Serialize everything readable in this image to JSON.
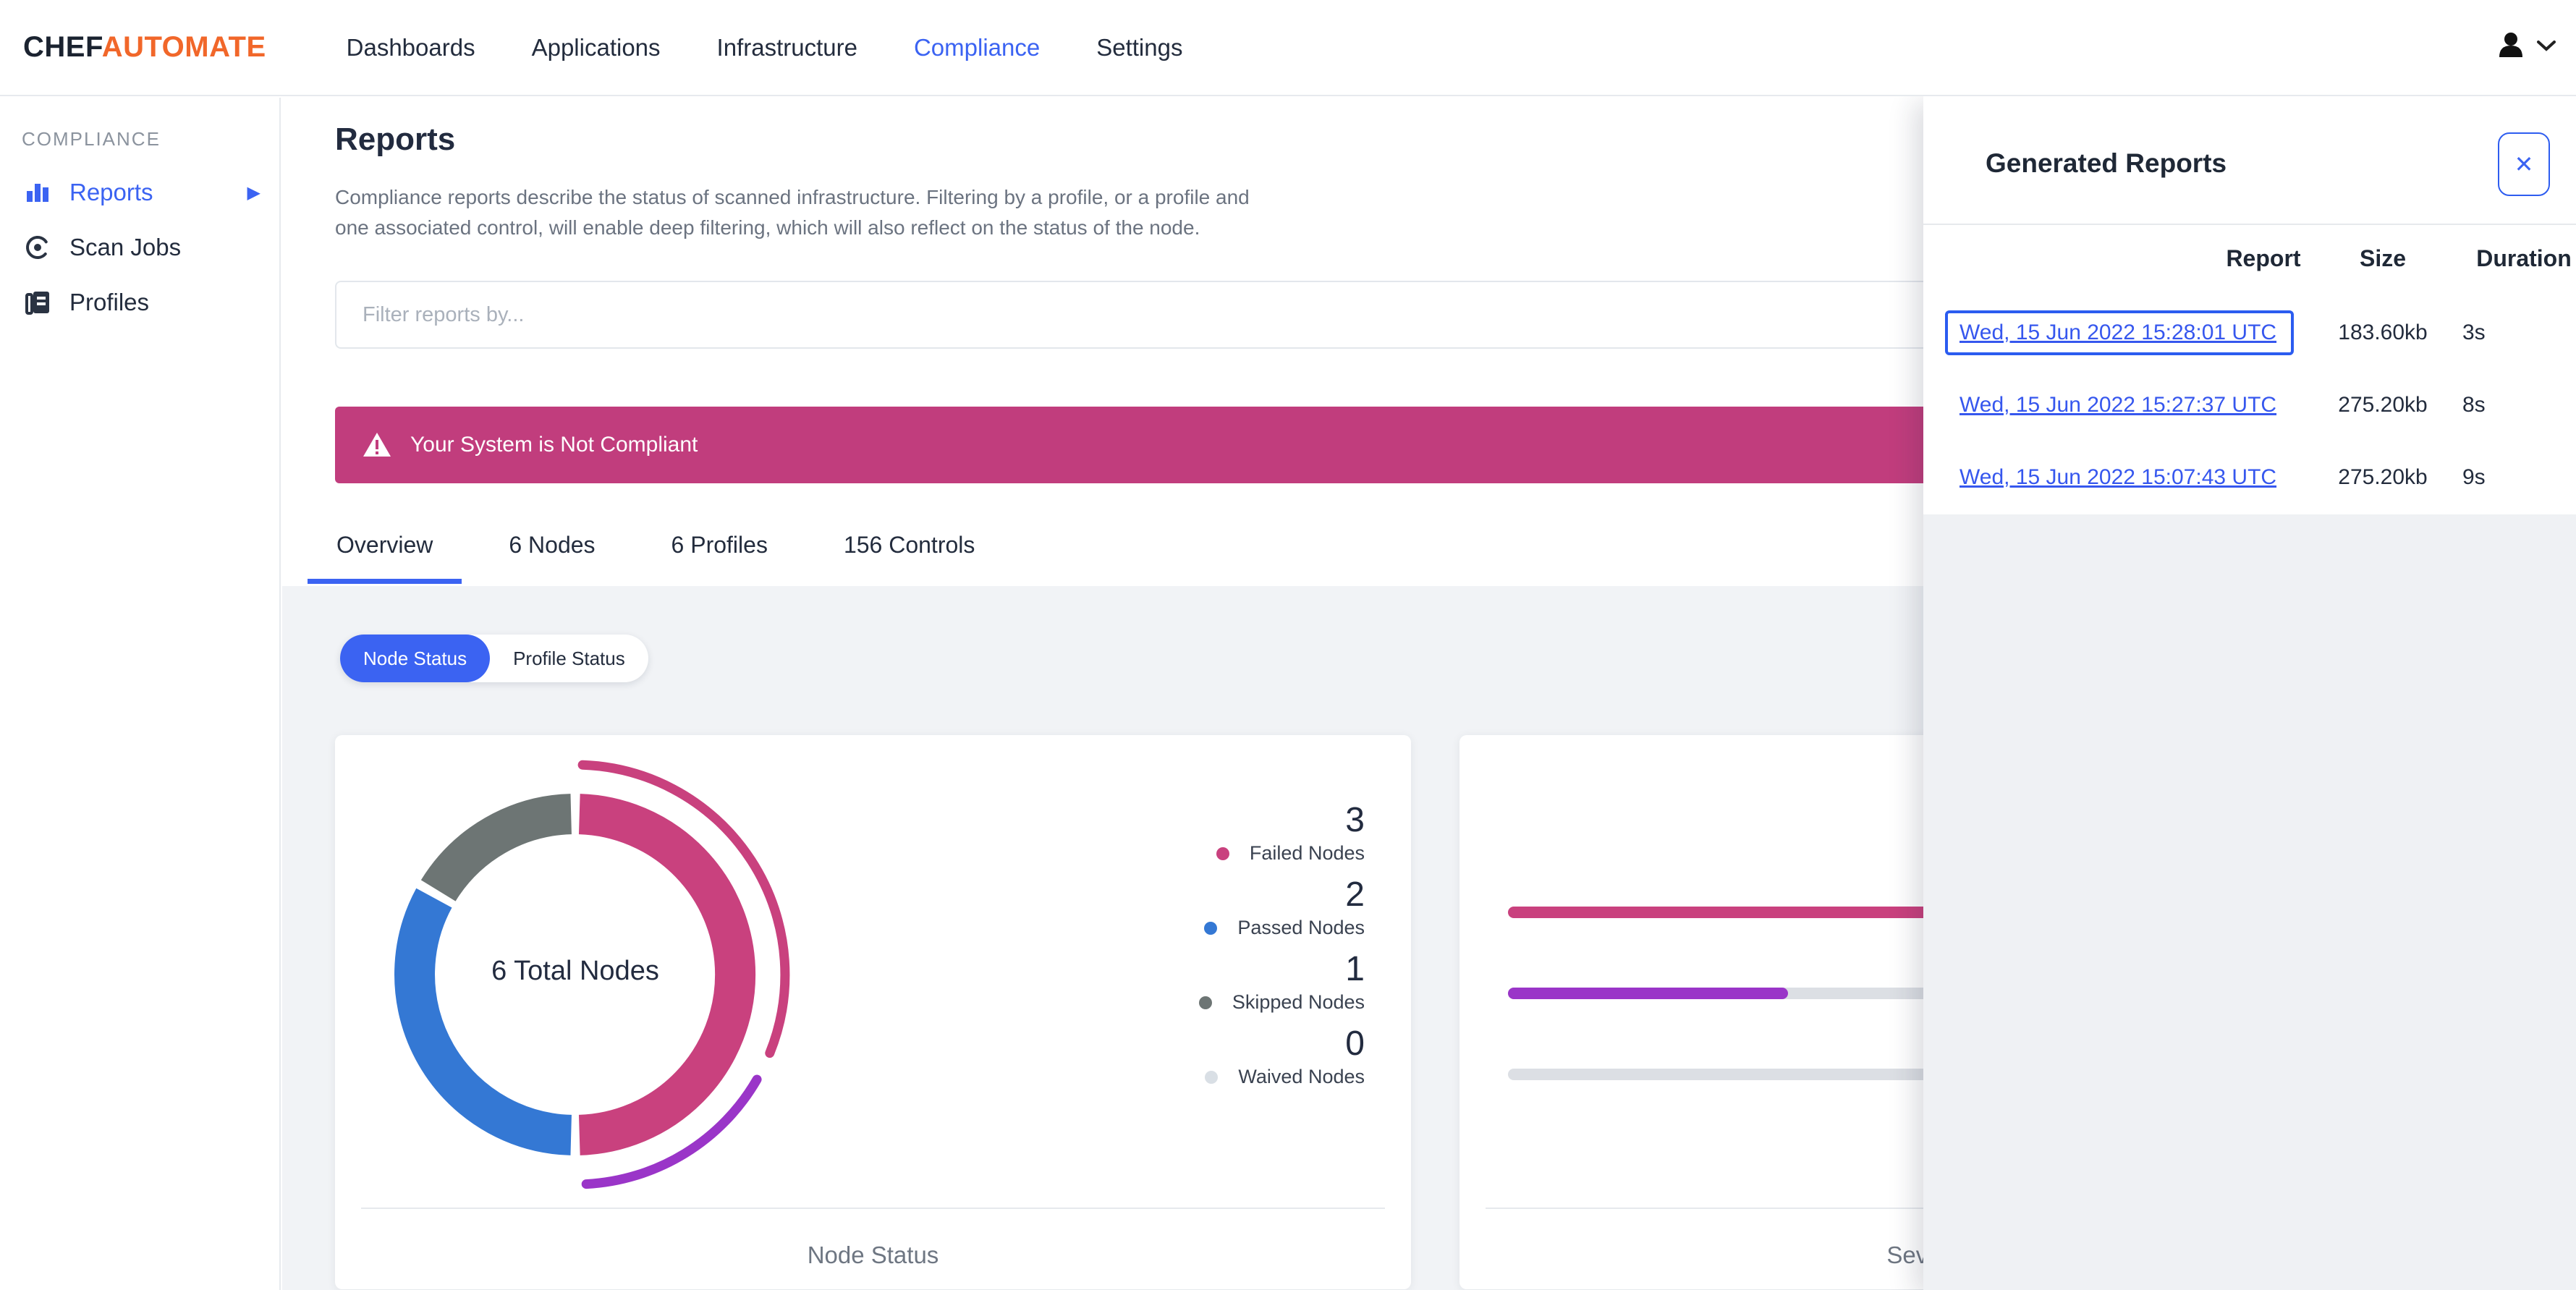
{
  "nav": {
    "brand_chef": "CHEF",
    "brand_automate": "AUTOMATE",
    "items": [
      {
        "label": "Dashboards",
        "active": false
      },
      {
        "label": "Applications",
        "active": false
      },
      {
        "label": "Infrastructure",
        "active": false
      },
      {
        "label": "Compliance",
        "active": true
      },
      {
        "label": "Settings",
        "active": false
      }
    ]
  },
  "sidebar": {
    "section_label": "COMPLIANCE",
    "items": [
      {
        "label": "Reports",
        "icon": "bar-chart-icon",
        "active": true,
        "has_submenu": true
      },
      {
        "label": "Scan Jobs",
        "icon": "radar-icon",
        "active": false
      },
      {
        "label": "Profiles",
        "icon": "documents-icon",
        "active": false
      }
    ]
  },
  "page": {
    "title": "Reports",
    "description_line1": "Compliance reports describe the status of scanned infrastructure. Filtering by a profile, or a profile and",
    "description_line2": "one associated control, will enable deep filtering, which will also reflect on the status of the node.",
    "filter_placeholder": "Filter reports by...",
    "alert_text": "Your System is Not Compliant"
  },
  "tabs": [
    {
      "label": "Overview",
      "active": true
    },
    {
      "label": "6 Nodes",
      "active": false
    },
    {
      "label": "6 Profiles",
      "active": false
    },
    {
      "label": "156 Controls",
      "active": false
    }
  ],
  "toggle": {
    "options": [
      {
        "label": "Node Status",
        "active": true
      },
      {
        "label": "Profile Status",
        "active": false
      }
    ]
  },
  "chart_data": [
    {
      "type": "donut",
      "title": "Node Status",
      "center_label": "6 Total Nodes",
      "total": 6,
      "series": [
        {
          "label": "Failed Nodes",
          "value": 3,
          "color": "#c9417e"
        },
        {
          "label": "Passed Nodes",
          "value": 2,
          "color": "#3478d4"
        },
        {
          "label": "Skipped Nodes",
          "value": 1,
          "color": "#6d7574"
        },
        {
          "label": "Waived Nodes",
          "value": 0,
          "color": "#d9dfe5"
        }
      ],
      "outer_arcs": [
        {
          "color": "#c9417e",
          "from_deg": 2,
          "to_deg": 112
        },
        {
          "color": "#9a35c8",
          "from_deg": 120,
          "to_deg": 177
        }
      ],
      "legend_position": "right"
    },
    {
      "type": "bar",
      "title": "Severity",
      "orientation": "horizontal",
      "bars": [
        {
          "color": "#c9417e",
          "fill_pct": 100
        },
        {
          "color": "#9a35c8",
          "fill_pct": 33
        },
        {
          "color": "#dcdfe4",
          "fill_pct": 0
        }
      ],
      "track_color": "#dcdfe4"
    }
  ],
  "generated_reports": {
    "title": "Generated Reports",
    "close_label": "✕",
    "columns": [
      "Report",
      "Size",
      "Duration"
    ],
    "rows": [
      {
        "report": "Wed, 15 Jun 2022 15:28:01 UTC",
        "size": "183.60kb",
        "duration": "3s",
        "focused": true
      },
      {
        "report": "Wed, 15 Jun 2022 15:27:37 UTC",
        "size": "275.20kb",
        "duration": "8s",
        "focused": false
      },
      {
        "report": "Wed, 15 Jun 2022 15:07:43 UTC",
        "size": "275.20kb",
        "duration": "9s",
        "focused": false
      }
    ]
  },
  "colors": {
    "accent_blue": "#3b63f2",
    "alert_pink": "#c13d7d",
    "brand_orange": "#f1672a",
    "content_bg": "#f1f3f6",
    "link_blue": "#3657ee"
  }
}
